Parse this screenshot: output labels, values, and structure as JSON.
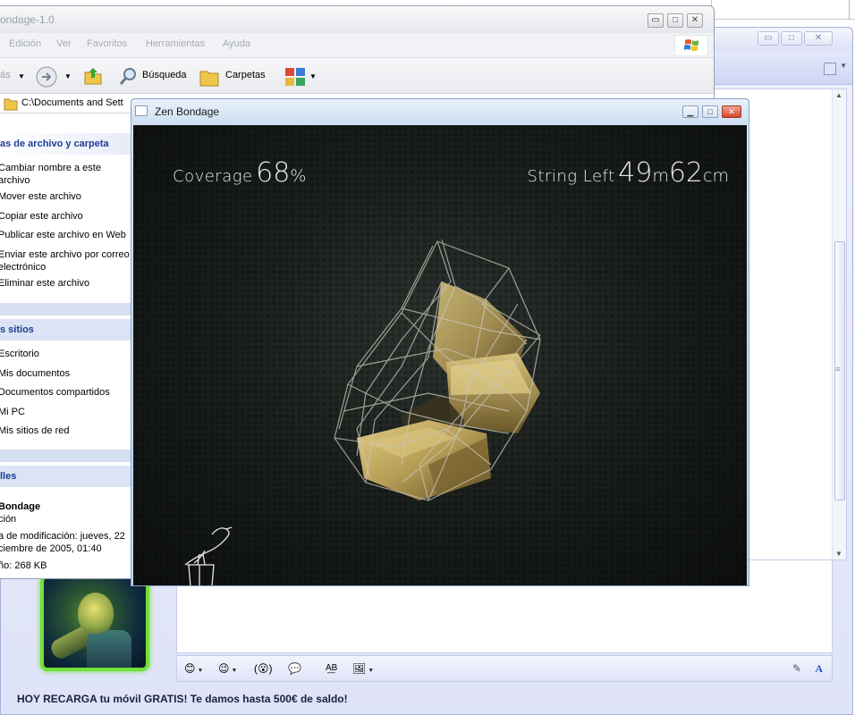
{
  "messenger": {
    "ad_text": "HOY RECARGA tu móvil GRATIS! Te damos hasta 500€ de saldo!",
    "window_buttons": [
      "▭",
      "□",
      "✕"
    ]
  },
  "explorer": {
    "title": "ondage-1.0",
    "menu": [
      "Edición",
      "Ver",
      "Favoritos",
      "Herramientas",
      "Ayuda"
    ],
    "menu_cut": "ás",
    "toolbar": {
      "search_label": "Búsqueda",
      "folders_label": "Carpetas"
    },
    "address": "C:\\Documents and Sett",
    "file_tasks": {
      "header": "as de archivo y carpeta",
      "items": [
        "Cambiar nombre a este archivo",
        "Mover este archivo",
        "Copiar este archivo",
        "Publicar este archivo en Web",
        "Enviar este archivo por correo electrónico",
        "Eliminar este archivo"
      ]
    },
    "other_places": {
      "header": "s sitios",
      "items": [
        "Escritorio",
        "Mis documentos",
        "Documentos compartidos",
        "Mi PC",
        "Mis sitios de red"
      ]
    },
    "details": {
      "header": "lles",
      "name": "Bondage",
      "type": "ción",
      "modified": "a de modificación: jueves, 22 ciembre de 2005, 01:40",
      "size": "ño: 268 KB"
    }
  },
  "game": {
    "title": "Zen Bondage",
    "coverage_label": "Coverage",
    "coverage_value": "68",
    "coverage_unit": "%",
    "string_label": "String Left",
    "string_m": "49",
    "string_m_unit": "m",
    "string_cm": "62",
    "string_cm_unit": "cm"
  },
  "colors": {
    "accent": "#1c3e94",
    "game_bg": "#1b201d",
    "sculpture_gold": "#b9a35c",
    "avatar_frame": "#72e03a"
  }
}
